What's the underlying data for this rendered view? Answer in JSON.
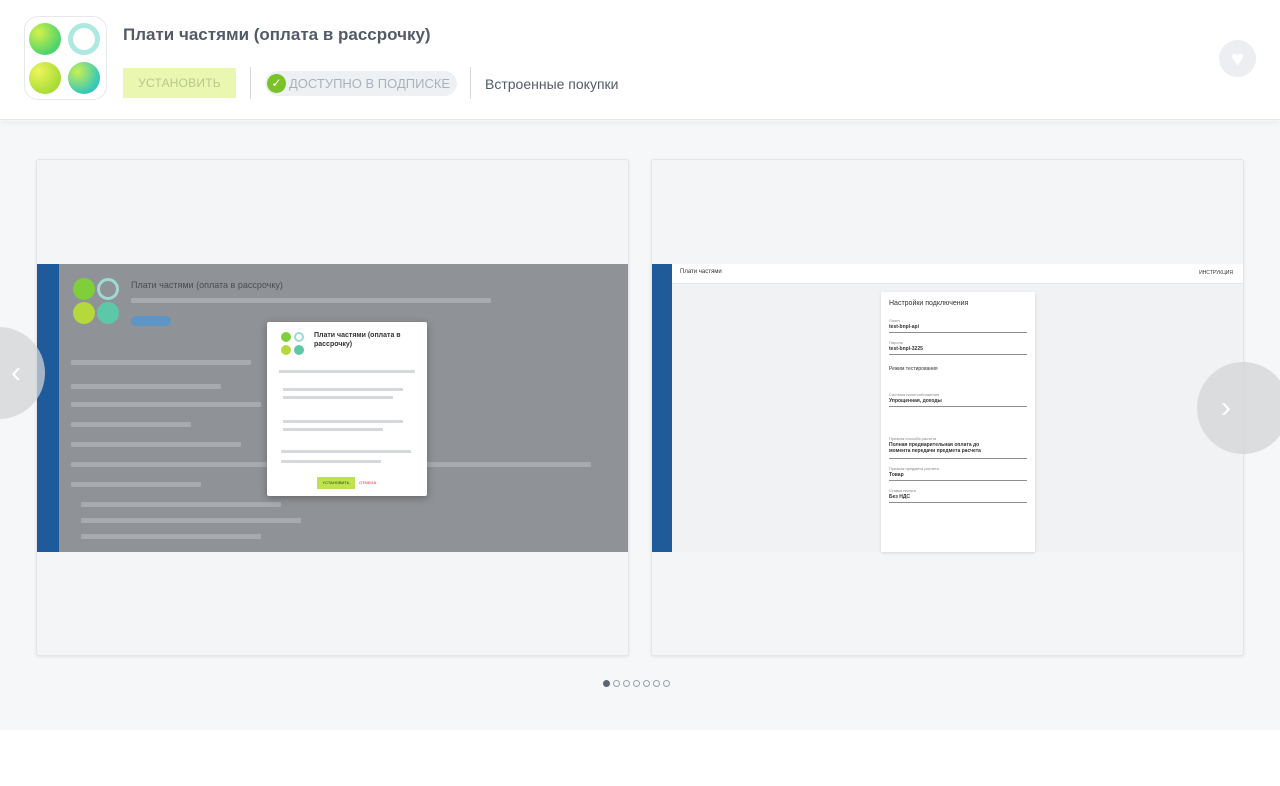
{
  "app": {
    "title": "Плати частями (оплата в рассрочку)",
    "install_label": "УСТАНОВИТЬ",
    "subscription_label": "ДОСТУПНО В ПОДПИСКЕ",
    "purchases_label": "Встроенные покупки"
  },
  "colors": {
    "install_bg": "#eaf7b0",
    "check_green": "#7bc229",
    "gallery_bg": "#f5f7f8"
  },
  "icons": {
    "favorite": "heart-icon",
    "subscription": "check-circle-icon",
    "prev": "chevron-left-icon",
    "next": "chevron-right-icon"
  },
  "gallery": {
    "screenshot1": {
      "app_title": "Плати частями (оплата в рассрочку)",
      "modal_title": "Плати частями (оплата в рассрочку)",
      "modal_install": "УСТАНОВИТЬ",
      "modal_cancel": "ОТМЕНА"
    },
    "screenshot2": {
      "brand": "Плати частями",
      "instruction": "ИНСТРУКЦИЯ",
      "form_title": "Настройки подключения",
      "login_label": "Логин",
      "login_value": "test-bnpl-api",
      "password_label": "Пароль",
      "password_value": "test-bnpl-3225",
      "mode_label": "Режим тестирования",
      "taxation_label": "Система налогообложения",
      "taxation_value": "Упрощенная, доходы",
      "payment_label": "Признак способа расчета",
      "payment_value": "Полная предварительная оплата до момента передачи предмета расчета",
      "subject_label": "Признак предмета расчета",
      "subject_value": "Товар",
      "vat_label": "Ставка налога",
      "vat_value": "Без НДС"
    },
    "pages": [
      1,
      2,
      3,
      4,
      5,
      6,
      7
    ],
    "active_page": 1
  }
}
